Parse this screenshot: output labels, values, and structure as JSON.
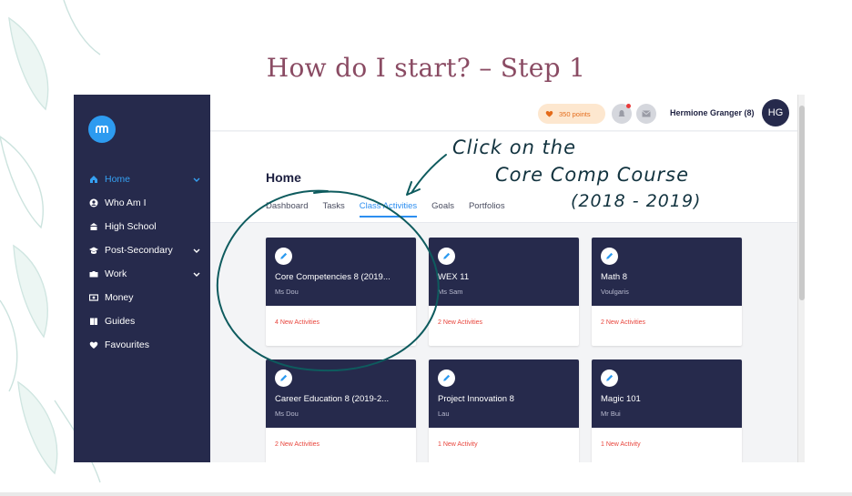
{
  "slide": {
    "title": "How do I start? – Step 1",
    "handwritten_note": [
      "Click on the",
      "Core Comp Course",
      "(2018 - 2019)"
    ]
  },
  "sidebar": {
    "logo_icon": "m-logo-icon",
    "items": [
      {
        "label": "Home",
        "icon": "home-icon",
        "active": true,
        "chevron": true
      },
      {
        "label": "Who Am I",
        "icon": "person-icon",
        "active": false,
        "chevron": false
      },
      {
        "label": "High School",
        "icon": "school-icon",
        "active": false,
        "chevron": false
      },
      {
        "label": "Post-Secondary",
        "icon": "graduation-cap-icon",
        "active": false,
        "chevron": true
      },
      {
        "label": "Work",
        "icon": "briefcase-icon",
        "active": false,
        "chevron": true
      },
      {
        "label": "Money",
        "icon": "money-icon",
        "active": false,
        "chevron": false
      },
      {
        "label": "Guides",
        "icon": "book-icon",
        "active": false,
        "chevron": false
      },
      {
        "label": "Favourites",
        "icon": "heart-icon",
        "active": false,
        "chevron": false
      }
    ]
  },
  "topbar": {
    "points": "350 points",
    "user_name": "Hermione Granger (8)",
    "avatar_initials": "HG"
  },
  "main": {
    "page_title": "Home",
    "tabs": [
      {
        "label": "Dashboard",
        "active": false
      },
      {
        "label": "Tasks",
        "active": false
      },
      {
        "label": "Class Activities",
        "active": true
      },
      {
        "label": "Goals",
        "active": false
      },
      {
        "label": "Portfolios",
        "active": false
      }
    ],
    "cards": [
      {
        "title": "Core Competencies 8 (2019...",
        "teacher": "Ms Dou",
        "new": "4 New Activities"
      },
      {
        "title": "WEX 11",
        "teacher": "Ms Sam",
        "new": "2 New Activities"
      },
      {
        "title": "Math 8",
        "teacher": "Voulgaris",
        "new": "2 New Activities"
      },
      {
        "title": "Career Education 8 (2019-2...",
        "teacher": "Ms Dou",
        "new": "2 New Activities"
      },
      {
        "title": "Project Innovation 8",
        "teacher": "Lau",
        "new": "1 New Activity"
      },
      {
        "title": "Magic 101",
        "teacher": "Mr Bui",
        "new": "1 New Activity"
      }
    ]
  },
  "colors": {
    "title": "#8a4b63",
    "sidebar": "#262a4c",
    "accent": "#2c8ef0",
    "alert": "#e8453c",
    "ink": "#12333f"
  }
}
